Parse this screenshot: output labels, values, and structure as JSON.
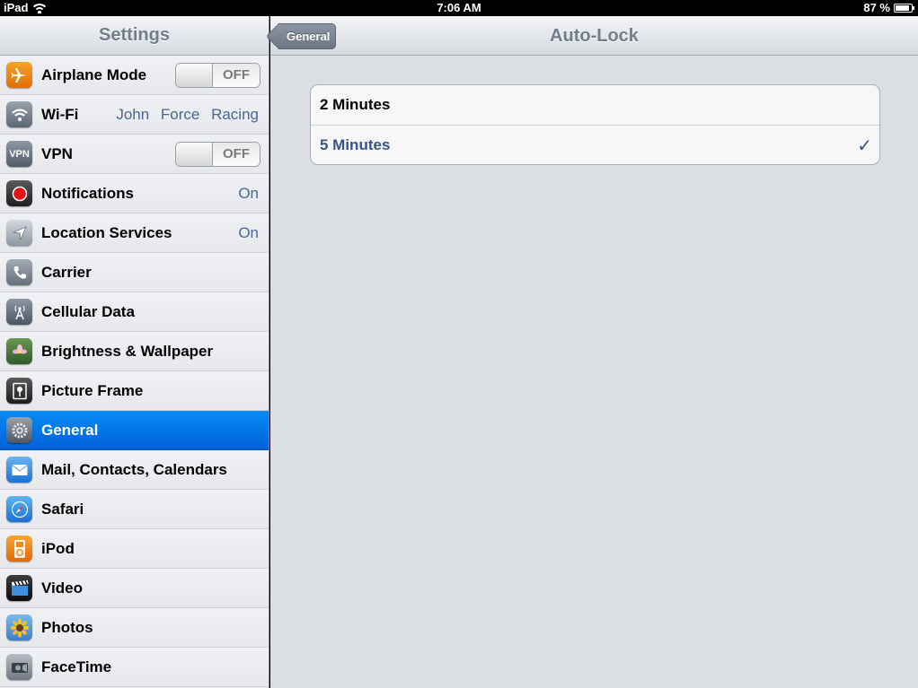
{
  "status_bar": {
    "device": "iPad",
    "time": "7:06 AM",
    "battery_text": "87 %",
    "battery_level": 0.87
  },
  "left_panel": {
    "title": "Settings",
    "items": [
      {
        "label": "Airplane Mode",
        "icon": "airplane-icon",
        "toggle": "OFF"
      },
      {
        "label": "Wi-Fi",
        "icon": "wifi-icon",
        "value": "John Force Racing"
      },
      {
        "label": "VPN",
        "icon": "vpn-icon",
        "icon_text": "VPN",
        "toggle": "OFF"
      },
      {
        "label": "Notifications",
        "icon": "notifications-icon",
        "value": "On"
      },
      {
        "label": "Location Services",
        "icon": "location-arrow-icon",
        "value": "On"
      },
      {
        "label": "Carrier",
        "icon": "phone-icon"
      },
      {
        "label": "Cellular Data",
        "icon": "antenna-icon"
      },
      {
        "label": "Brightness & Wallpaper",
        "icon": "flower-icon"
      },
      {
        "label": "Picture Frame",
        "icon": "picture-frame-icon"
      },
      {
        "label": "General",
        "icon": "gear-icon",
        "selected": true
      },
      {
        "label": "Mail, Contacts, Calendars",
        "icon": "mail-icon"
      },
      {
        "label": "Safari",
        "icon": "compass-icon"
      },
      {
        "label": "iPod",
        "icon": "ipod-icon"
      },
      {
        "label": "Video",
        "icon": "clapperboard-icon"
      },
      {
        "label": "Photos",
        "icon": "sunflower-icon"
      },
      {
        "label": "FaceTime",
        "icon": "camera-icon"
      }
    ]
  },
  "right_panel": {
    "back_button": "General",
    "title": "Auto-Lock",
    "options": [
      {
        "label": "2 Minutes",
        "checked": false
      },
      {
        "label": "5 Minutes",
        "checked": true
      }
    ],
    "check_glyph": "✓"
  },
  "colors": {
    "selected_row": "#0a6fe8",
    "value_text": "#4b6694",
    "checked_text": "#385487"
  }
}
